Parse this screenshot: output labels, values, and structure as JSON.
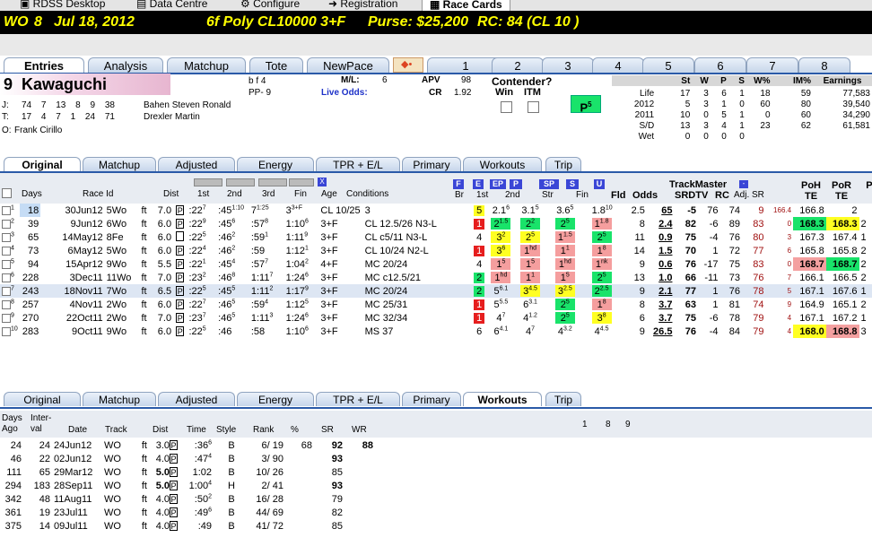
{
  "app_tabs": [
    "RDSS Desktop",
    "Data Centre",
    "Configure",
    "Registration",
    "Race Cards"
  ],
  "header": {
    "track": "WO",
    "race": "8",
    "date": "Jul 18, 2012",
    "cond": "6f Poly CL10000 3+F",
    "purse": "Purse: $25,200",
    "rc": "RC: 84 (CL 10 )"
  },
  "top_tabs": [
    "Entries",
    "Analysis",
    "Matchup",
    "Tote",
    "NewPace",
    "1",
    "2",
    "3",
    "4",
    "5",
    "6",
    "7",
    "8"
  ],
  "horse": {
    "pp": "9",
    "name": "Kawaguchi",
    "bf": "b f 4",
    "ppline": "PP- 9",
    "ml_label": "M/L:",
    "ml": "6",
    "live_odds": "Live Odds:",
    "apv_label": "APV",
    "apv": "98",
    "cr_label": "CR",
    "cr": "1.92",
    "j_label": "J:",
    "j": "74  7  13  8  9  38",
    "jockey": "Bahen Steven Ronald",
    "t_label": "T:",
    "t": "17  4  7  1  24  71",
    "trainer": "Drexler Martin",
    "o_label": "O:",
    "owner": "Frank Cirillo",
    "contender": "Contender?",
    "win": "Win",
    "itm": "ITM",
    "p5": "P",
    "p5sub": "5"
  },
  "records": {
    "headers": [
      "St",
      "W",
      "P",
      "S",
      "W%",
      "IM%",
      "Earnings"
    ],
    "rows": [
      [
        "Life",
        "17",
        "3",
        "6",
        "1",
        "18",
        "59",
        "77,583"
      ],
      [
        "2012",
        "5",
        "3",
        "1",
        "0",
        "60",
        "80",
        "39,540"
      ],
      [
        "2011",
        "10",
        "0",
        "5",
        "1",
        "0",
        "60",
        "34,290"
      ],
      [
        "S/D",
        "13",
        "3",
        "4",
        "1",
        "23",
        "62",
        "61,581"
      ],
      [
        "Wet",
        "0",
        "0",
        "0",
        "0",
        "",
        "",
        ""
      ]
    ]
  },
  "sub_tabs": [
    "Original",
    "Matchup",
    "Adjusted",
    "Energy",
    "TPR + E/L",
    "Primary",
    "Workouts",
    "Trip"
  ],
  "grid": {
    "headers": [
      "Days",
      "Race Id",
      "Dist",
      "1st",
      "2nd",
      "3rd",
      "Fin",
      "Age",
      "Conditions",
      "Br",
      "1st",
      "2nd",
      "Str",
      "Fin",
      "Fld",
      "Odds",
      "SRDTV",
      "RC",
      "Adj. SR",
      "PoH TE",
      "PoR TE",
      "Pe"
    ],
    "hdr_buttons": [
      "F",
      "E",
      "EP",
      "P",
      "SP",
      "S",
      "U"
    ],
    "tm_label": "TrackMaster",
    "x_label": "X",
    "rows": [
      [
        "1",
        "18",
        "30Jun12",
        "5Wo",
        "ft",
        "7.0",
        "P",
        ":22",
        "7",
        ":45",
        "1:10",
        "7",
        "1:25",
        "3",
        "3+F",
        "CL 10/25",
        "3",
        "5",
        "2.1",
        "6",
        "3.1",
        "5",
        "3.6",
        "5",
        "1.8",
        "10",
        "2.5",
        "65",
        "-5",
        "76",
        "74",
        "9",
        "166.4",
        "166.8",
        "2"
      ],
      [
        "2",
        "39",
        "9Jun12",
        "6Wo",
        "ft",
        "6.0",
        "P",
        ":22",
        "9",
        ":45",
        "6",
        ":57",
        "8",
        "1:10",
        "6",
        "3+F",
        "CL 12.5/26 N3-L",
        "1",
        "2",
        "1.5",
        "2",
        "2",
        "2",
        "5",
        "1",
        "1.8",
        "8",
        "2.4",
        "82",
        "-6",
        "89",
        "83",
        "0",
        "168.3",
        "168.3",
        "2"
      ],
      [
        "3",
        "65",
        "14May12",
        "8Fe",
        "ft",
        "6.0",
        "",
        ":22",
        "5",
        ":46",
        "2",
        ":59",
        "1",
        "1:11",
        "9",
        "3+F",
        "CL c5/11 N3-L",
        "4",
        "3",
        "2",
        "2",
        "5",
        "1",
        "1.5",
        "2",
        "5",
        "11",
        "0.9",
        "75",
        "-4",
        "76",
        "80",
        "3",
        "167.3",
        "167.4",
        "1"
      ],
      [
        "4",
        "73",
        "6May12",
        "5Wo",
        "ft",
        "6.0",
        "P",
        ":22",
        "4",
        ":46",
        "2",
        ":59",
        "",
        "1:12",
        "1",
        "3+F",
        "CL 10/24 N2-L",
        "1",
        "3",
        "6",
        "1",
        "hd",
        "1",
        "1",
        "1",
        "8",
        "14",
        "1.5",
        "70",
        "1",
        "72",
        "77",
        "6",
        "165.8",
        "165.8",
        "2"
      ],
      [
        "5",
        "94",
        "15Apr12",
        "9Wo",
        "ft",
        "5.5",
        "P",
        ":22",
        "1",
        ":45",
        "4",
        ":57",
        "7",
        "1:04",
        "2",
        "4+F",
        "MC 20/24",
        "4",
        "1",
        "5",
        "1",
        "5",
        "1",
        "hd",
        "1",
        "nk",
        "9",
        "0.6",
        "76",
        "-17",
        "75",
        "83",
        "0",
        "168.7",
        "168.7",
        "2"
      ],
      [
        "6",
        "228",
        "3Dec11",
        "11Wo",
        "ft",
        "7.0",
        "P",
        ":23",
        "2",
        ":46",
        "8",
        "1:11",
        "7",
        "1:24",
        "6",
        "3+F",
        "MC c12.5/21",
        "2",
        "1",
        "hd",
        "1",
        "1",
        "1",
        "5",
        "2",
        "5",
        "13",
        "1.0",
        "66",
        "-11",
        "73",
        "76",
        "7",
        "166.1",
        "166.5",
        "2"
      ],
      [
        "7",
        "243",
        "18Nov11",
        "7Wo",
        "ft",
        "6.5",
        "P",
        ":22",
        "5",
        ":45",
        "5",
        "1:11",
        "2",
        "1:17",
        "9",
        "3+F",
        "MC 20/24",
        "2",
        "5",
        "6.1",
        "3",
        "4.5",
        "3",
        "2.5",
        "2",
        "2.5",
        "9",
        "2.1",
        "77",
        "1",
        "76",
        "78",
        "5",
        "167.1",
        "167.6",
        "1"
      ],
      [
        "8",
        "257",
        "4Nov11",
        "2Wo",
        "ft",
        "6.0",
        "P",
        ":22",
        "7",
        ":46",
        "5",
        ":59",
        "4",
        "1:12",
        "5",
        "3+F",
        "MC 25/31",
        "1",
        "5",
        "5.5",
        "6",
        "3.1",
        "2",
        "5",
        "1",
        "8",
        "8",
        "3.7",
        "63",
        "1",
        "81",
        "74",
        "9",
        "164.9",
        "165.1",
        "2"
      ],
      [
        "9",
        "270",
        "22Oct11",
        "2Wo",
        "ft",
        "7.0",
        "P",
        ":23",
        "7",
        ":46",
        "5",
        "1:11",
        "3",
        "1:24",
        "6",
        "3+F",
        "MC 32/34",
        "1",
        "4",
        "7",
        "4",
        "1.2",
        "2",
        "5",
        "3",
        "8",
        "6",
        "3.7",
        "75",
        "-6",
        "78",
        "79",
        "4",
        "167.1",
        "167.2",
        "1"
      ],
      [
        "10",
        "283",
        "9Oct11",
        "9Wo",
        "ft",
        "6.0",
        "P",
        ":22",
        "5",
        ":46",
        "",
        ":58",
        "",
        "1:10",
        "6",
        "3+F",
        "MS 37",
        "6",
        "6",
        "4.1",
        "4",
        "7",
        "4",
        "3.2",
        "4",
        "4.5",
        "9",
        "26.5",
        "76",
        "-4",
        "84",
        "79",
        "4",
        "168.0",
        "168.8",
        "3"
      ]
    ]
  },
  "workouts": {
    "headers": [
      "Days Ago",
      "Inter-val",
      "Date",
      "Track",
      "Dist",
      "Time",
      "Style",
      "Rank",
      "%",
      "SR",
      "WR"
    ],
    "marks": [
      "1",
      "8",
      "9"
    ],
    "rows": [
      [
        "24",
        "24",
        "24Jun12",
        "WO",
        "ft",
        "3.0",
        "P",
        ":36",
        "6",
        "B",
        "6/ 19",
        "68",
        "92",
        "88"
      ],
      [
        "46",
        "22",
        "02Jun12",
        "WO",
        "ft",
        "4.0",
        "P",
        ":47",
        "4",
        "B",
        "3/ 90",
        "",
        "93",
        ""
      ],
      [
        "111",
        "65",
        "29Mar12",
        "WO",
        "ft",
        "5.0",
        "P",
        "1:02",
        "",
        "B",
        "10/ 26",
        "",
        "85",
        ""
      ],
      [
        "294",
        "183",
        "28Sep11",
        "WO",
        "ft",
        "5.0",
        "P",
        "1:00",
        "4",
        "H",
        "2/ 41",
        "",
        "93",
        ""
      ],
      [
        "342",
        "48",
        "11Aug11",
        "WO",
        "ft",
        "4.0",
        "P",
        ":50",
        "2",
        "B",
        "16/ 28",
        "",
        "79",
        ""
      ],
      [
        "361",
        "19",
        "23Jul11",
        "WO",
        "ft",
        "4.0",
        "P",
        ":49",
        "6",
        "B",
        "44/ 69",
        "",
        "82",
        ""
      ],
      [
        "375",
        "14",
        "09Jul11",
        "WO",
        "ft",
        "4.0",
        "P",
        ":49",
        "",
        "B",
        "41/ 72",
        "",
        "85",
        ""
      ]
    ]
  }
}
